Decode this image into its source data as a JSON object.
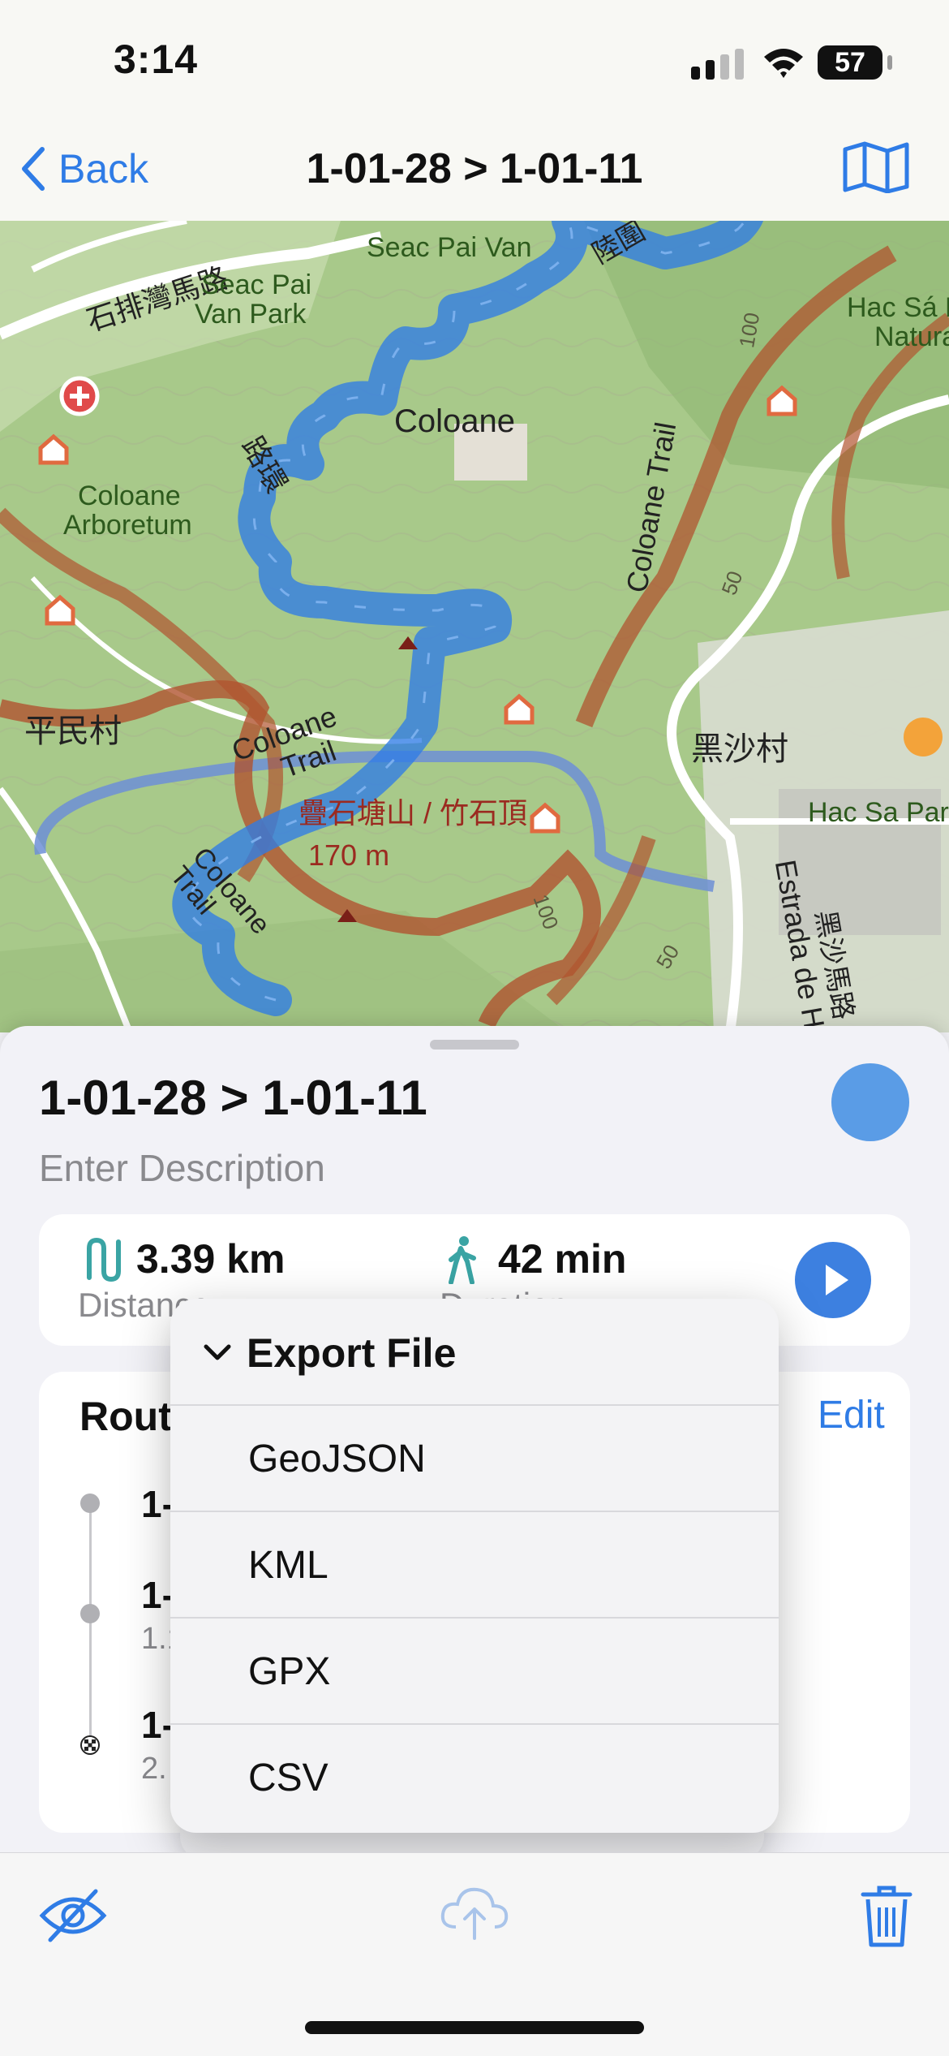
{
  "status_bar": {
    "time": "3:14",
    "battery": "57"
  },
  "nav": {
    "back_label": "Back",
    "title": "1-01-28 > 1-01-11",
    "map_icon": "map-book-icon"
  },
  "map": {
    "labels": [
      {
        "id": "seac-pai-van-cn",
        "text": "石排灣馬路"
      },
      {
        "id": "seac-pai-van",
        "text": "Seac Pai Van"
      },
      {
        "id": "seac-pai-van-park",
        "text": "Seac Pai\nVan Park"
      },
      {
        "id": "coloane",
        "text": "Coloane"
      },
      {
        "id": "coloane-arboretum",
        "text": "Coloane\nArboretum"
      },
      {
        "id": "coloane-trail-1",
        "text": "Coloane\nTrail"
      },
      {
        "id": "coloane-trail-2",
        "text": "Coloane Trail"
      },
      {
        "id": "coloane-trail-3",
        "text": "Coloane\nTrail"
      },
      {
        "id": "hac-sa-natura",
        "text": "Hac Sá R\nNatura"
      },
      {
        "id": "hac-sa-park",
        "text": "Hac Sa Park"
      },
      {
        "id": "peng-man-chun",
        "text": "平民村"
      },
      {
        "id": "hac-sa-chun",
        "text": "黑沙村"
      },
      {
        "id": "alto",
        "text": "疊石塘山 / 竹石頂"
      },
      {
        "id": "elevation",
        "text": "170 m"
      },
      {
        "id": "estrada",
        "text": "Estrada de H"
      },
      {
        "id": "hac-sa-road",
        "text": "黑沙馬路"
      },
      {
        "id": "road-cn-1",
        "text": "路環"
      },
      {
        "id": "road-cn-2",
        "text": "陸圍"
      },
      {
        "id": "contour-100-a",
        "text": "100"
      },
      {
        "id": "contour-50-a",
        "text": "50"
      },
      {
        "id": "contour-100-b",
        "text": "100"
      },
      {
        "id": "contour-50-b",
        "text": "50"
      }
    ]
  },
  "sheet": {
    "route_title": "1-01-28 > 1-01-11",
    "description_placeholder": "Enter Description",
    "route_color": "#5a9ce6",
    "stats": {
      "distance_value": "3.39 km",
      "distance_label": "Distance",
      "duration_value": "42 min",
      "duration_label": "Duration"
    },
    "route_section": {
      "label": "Route",
      "edit_label": "Edit",
      "waypoints": [
        {
          "name": "1-",
          "sub": ""
        },
        {
          "name": "1-",
          "sub": "1.1"
        },
        {
          "name": "1-",
          "sub": "2."
        }
      ]
    }
  },
  "export_menu": {
    "header": "Export File",
    "options": [
      "GeoJSON",
      "KML",
      "GPX",
      "CSV"
    ]
  },
  "toolbar": {
    "hide_icon": "eye-slash-icon",
    "upload_icon": "cloud-upload-icon",
    "delete_icon": "trash-icon"
  },
  "colors": {
    "accent": "#2f7ce6",
    "route": "#3b86e8",
    "trail": "#b0542f"
  }
}
